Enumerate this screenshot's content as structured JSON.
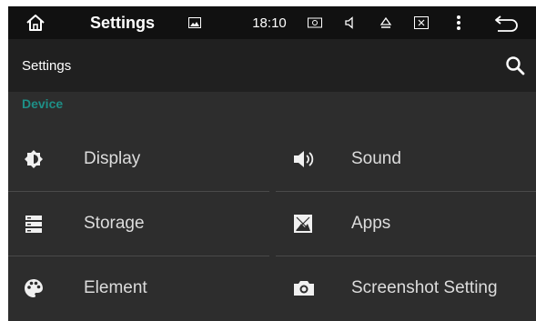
{
  "statusbar": {
    "title": "Settings",
    "time": "18:10",
    "icons": [
      "home-icon",
      "gallery-icon",
      "screenshot-icon",
      "volume-icon",
      "eject-icon",
      "close-window-icon",
      "more-vert-icon",
      "back-icon"
    ]
  },
  "appbar": {
    "title": "Settings",
    "search_icon": "search-icon"
  },
  "section": {
    "label": "Device",
    "color": "#1e8f87"
  },
  "tiles": [
    {
      "label": "Display",
      "icon": "brightness-icon"
    },
    {
      "label": "Sound",
      "icon": "speaker-icon"
    },
    {
      "label": "Storage",
      "icon": "storage-icon"
    },
    {
      "label": "Apps",
      "icon": "apps-icon"
    },
    {
      "label": "Element",
      "icon": "palette-icon"
    },
    {
      "label": "Screenshot Setting",
      "icon": "camera-icon"
    }
  ]
}
